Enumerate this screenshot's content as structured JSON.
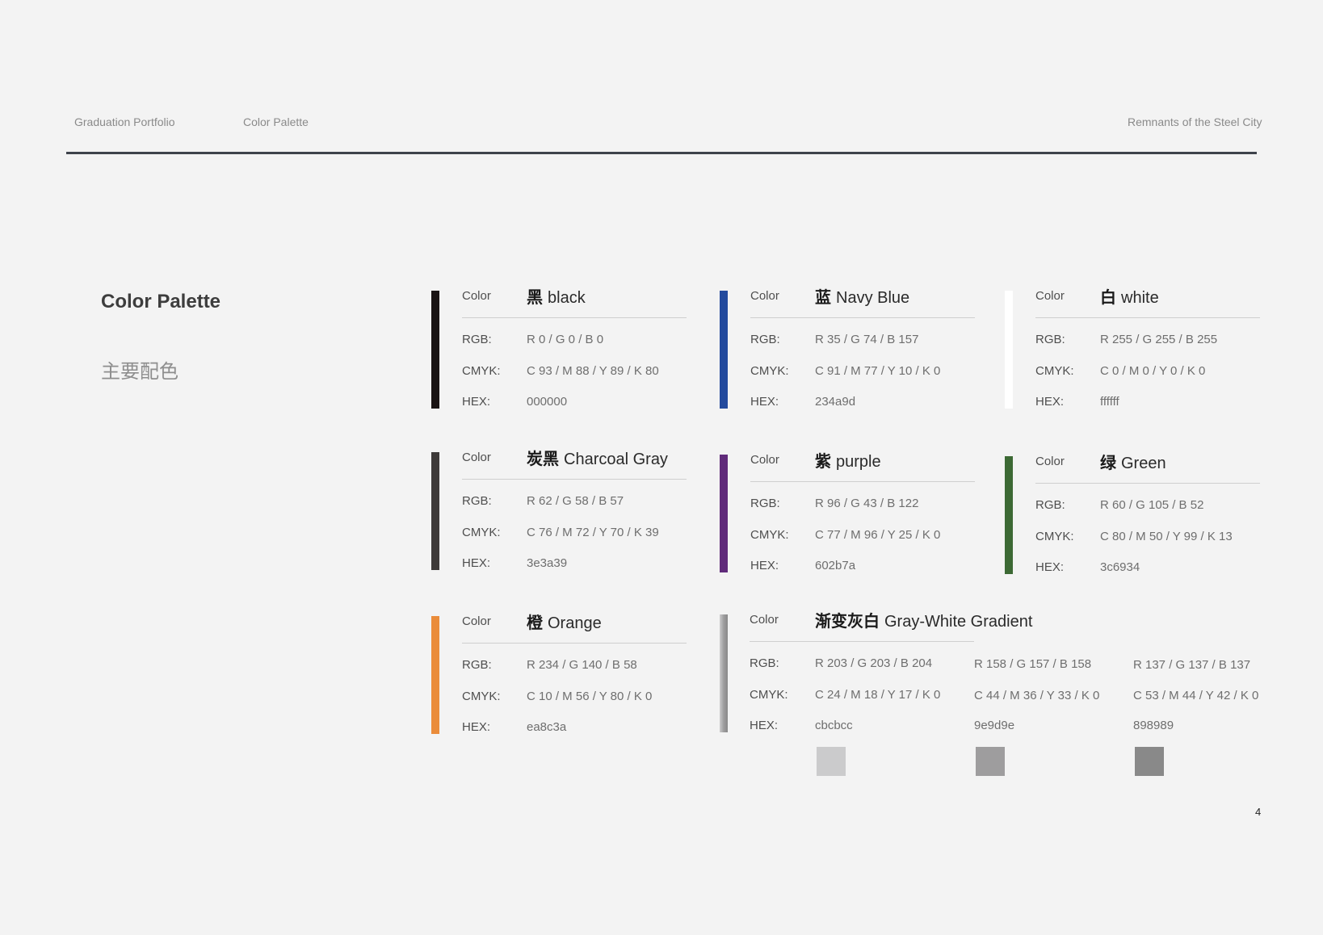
{
  "header": {
    "left": "Graduation Portfolio",
    "center": "Color Palette",
    "right": "Remnants of the Steel City"
  },
  "page": {
    "title": "Color Palette",
    "subtitle": "主要配色",
    "number": "4"
  },
  "labels": {
    "color": "Color",
    "rgb": "RGB:",
    "cmyk": "CMYK:",
    "hex": "HEX:"
  },
  "colors": [
    {
      "cn": "黑",
      "en": "black",
      "rgb": "R 0 / G 0 / B 0",
      "cmyk": "C 93 / M 88 / Y 89 / K 80",
      "hex": "000000",
      "swatch": "#1a1414"
    },
    {
      "cn": "蓝",
      "en": "Navy Blue",
      "rgb": "R 35 / G 74 / B 157",
      "cmyk": "C 91 / M 77 / Y 10 / K 0",
      "hex": "234a9d",
      "swatch": "#234a9d"
    },
    {
      "cn": "白",
      "en": "white",
      "rgb": "R 255 / G 255 / B 255",
      "cmyk": "C 0 / M 0 / Y 0 / K 0",
      "hex": "ffffff",
      "swatch": "#ffffff"
    },
    {
      "cn": "炭黑",
      "en": "Charcoal Gray",
      "rgb": "R 62 / G 58 / B 57",
      "cmyk": "C 76 / M 72 / Y 70 / K 39",
      "hex": "3e3a39",
      "swatch": "#3e3a39"
    },
    {
      "cn": "紫",
      "en": "purple",
      "rgb": "R 96 / G 43 / B 122",
      "cmyk": "C 77 / M 96 / Y 25 / K 0",
      "hex": "602b7a",
      "swatch": "#602b7a"
    },
    {
      "cn": "绿",
      "en": "Green",
      "rgb": "R 60 / G 105 / B 52",
      "cmyk": "C 80 / M 50 / Y 99 / K 13",
      "hex": "3c6934",
      "swatch": "#3c6934"
    },
    {
      "cn": "橙",
      "en": "Orange",
      "rgb": "R 234 / G 140 / B 58",
      "cmyk": "C 10 / M 56 / Y 80 / K 0",
      "hex": "ea8c3a",
      "swatch": "#ea8c3a"
    }
  ],
  "gradient": {
    "cn": "渐变灰白",
    "en": "Gray-White Gradient",
    "stops": [
      {
        "rgb": "R 203 / G 203 / B 204",
        "cmyk": "C 24 / M 18 / Y 17 / K 0",
        "hex": "cbcbcc",
        "swatch": "#cbcbcc"
      },
      {
        "rgb": "R 158 / G 157 / B 158",
        "cmyk": "C 44 / M 36 / Y 33 / K 0",
        "hex": "9e9d9e",
        "swatch": "#9e9d9e"
      },
      {
        "rgb": "R 137 / G 137 / B 137",
        "cmyk": "C 53 / M 44 / Y 42 / K 0",
        "hex": "898989",
        "swatch": "#898989"
      }
    ]
  }
}
